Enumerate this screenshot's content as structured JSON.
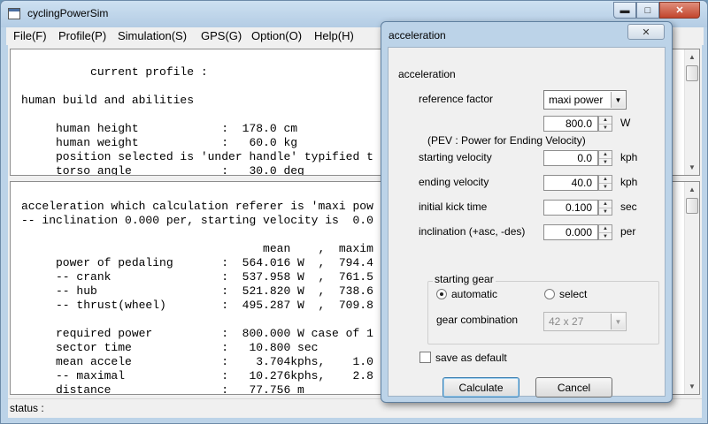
{
  "window": {
    "title": "cyclingPowerSim",
    "minimize_icon": "minimize-icon",
    "maximize_icon": "maximize-icon",
    "close_icon": "close-icon"
  },
  "menu": [
    "File(F)",
    "Profile(P)",
    "Simulation(S)",
    "GPS(G)",
    "Option(O)",
    "Help(H)"
  ],
  "top_pane": {
    "lines": [
      "          current profile :",
      "",
      "human build and abilities",
      "",
      "     human height            :  178.0 cm",
      "     human weight            :   60.0 kg",
      "     position selected is 'under handle' typified t",
      "     torso angle             :   30.0 deg"
    ]
  },
  "bottom_pane": {
    "lines": [
      "acceleration which calculation referer is 'maxi pow",
      "-- inclination 0.000 per, starting velocity is  0.0",
      "",
      "                                   mean    ,  maxim",
      "     power of pedaling       :  564.016 W  ,  794.4",
      "     -- crank                :  537.958 W  ,  761.5",
      "     -- hub                  :  521.820 W  ,  738.6",
      "     -- thrust(wheel)        :  495.287 W  ,  709.8",
      "",
      "     required power          :  800.000 W case of 1",
      "     sector time             :   10.800 sec",
      "     mean accele             :    3.704kphs,    1.0",
      "     -- maximal              :   10.276kphs,    2.8",
      "     distance                :   77.756 m"
    ]
  },
  "status": {
    "label": "status :"
  },
  "dialog": {
    "title": "acceleration",
    "close_icon": "close-icon",
    "heading": "acceleration",
    "reference_factor": {
      "label": "reference factor",
      "value": "maxi power"
    },
    "power": {
      "value": "800.0",
      "unit": "W"
    },
    "pev_note": "(PEV : Power for Ending Velocity)",
    "fields": [
      {
        "label": "starting velocity",
        "value": "0.0",
        "unit": "kph"
      },
      {
        "label": "ending velocity",
        "value": "40.0",
        "unit": "kph"
      },
      {
        "label": "initial kick time",
        "value": "0.100",
        "unit": "sec"
      },
      {
        "label": "inclination (+asc, -des)",
        "value": "0.000",
        "unit": "per"
      }
    ],
    "starting_gear": {
      "title": "starting gear",
      "automatic_label": "automatic",
      "select_label": "select",
      "selected": "automatic",
      "gear_combination_label": "gear combination",
      "gear_combination_value": "42 x 27"
    },
    "save_default_label": "save as default",
    "save_default_checked": false,
    "calculate_label": "Calculate",
    "cancel_label": "Cancel"
  }
}
